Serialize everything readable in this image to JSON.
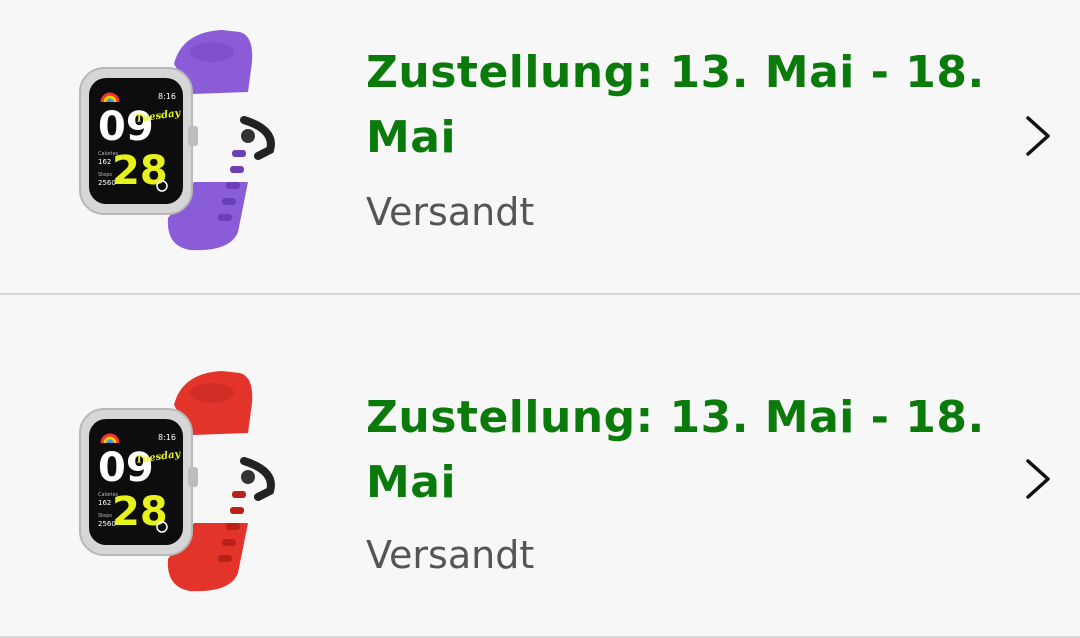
{
  "orders": [
    {
      "delivery": "Zustellung: 13. Mai - 18. Mai",
      "status": "Versandt",
      "product_image": "smartwatch-purple-band",
      "band_color": "#8a5cd8",
      "watch_face": {
        "time_hour": "09",
        "time_minute": "28",
        "time_small": "8:16",
        "day": "Tuesday",
        "calories_label": "Calories",
        "calories_value": "162",
        "steps_label": "Steps",
        "steps_value": "2560"
      }
    },
    {
      "delivery": "Zustellung: 13. Mai - 18. Mai",
      "status": "Versandt",
      "product_image": "smartwatch-red-band",
      "band_color": "#e3342b",
      "watch_face": {
        "time_hour": "09",
        "time_minute": "28",
        "time_small": "8:16",
        "day": "Tuesday",
        "calories_label": "Calories",
        "calories_value": "162",
        "steps_label": "Steps",
        "steps_value": "2560"
      }
    }
  ],
  "icons": {
    "chevron": "chevron-right-icon"
  },
  "colors": {
    "delivery_text": "#0a7a0a",
    "status_text": "#555555",
    "face_accent": "#e6f21c"
  }
}
